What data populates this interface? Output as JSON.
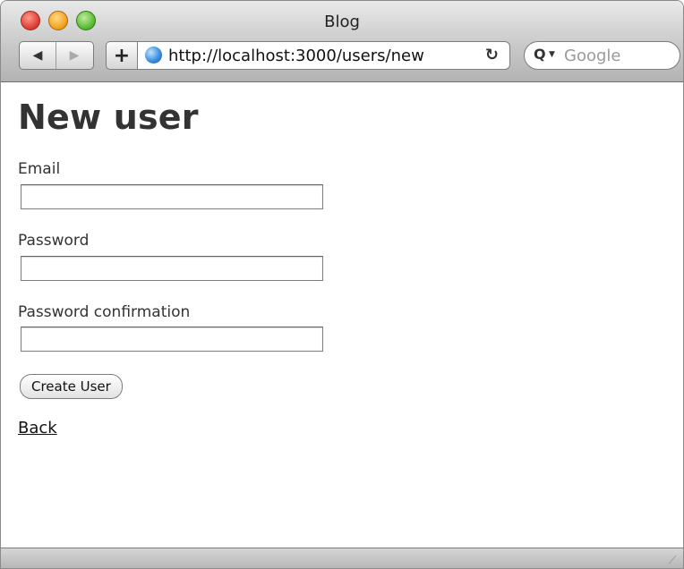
{
  "window": {
    "title": "Blog"
  },
  "toolbar": {
    "back_icon": "◀",
    "forward_icon": "▶",
    "add_icon": "+",
    "url": "http://localhost:3000/users/new",
    "reload_icon": "↻",
    "search_placeholder": "Google"
  },
  "page": {
    "heading": "New user",
    "fields": [
      {
        "label": "Email",
        "value": ""
      },
      {
        "label": "Password",
        "value": ""
      },
      {
        "label": "Password confirmation",
        "value": ""
      }
    ],
    "submit_label": "Create User",
    "back_label": "Back"
  }
}
